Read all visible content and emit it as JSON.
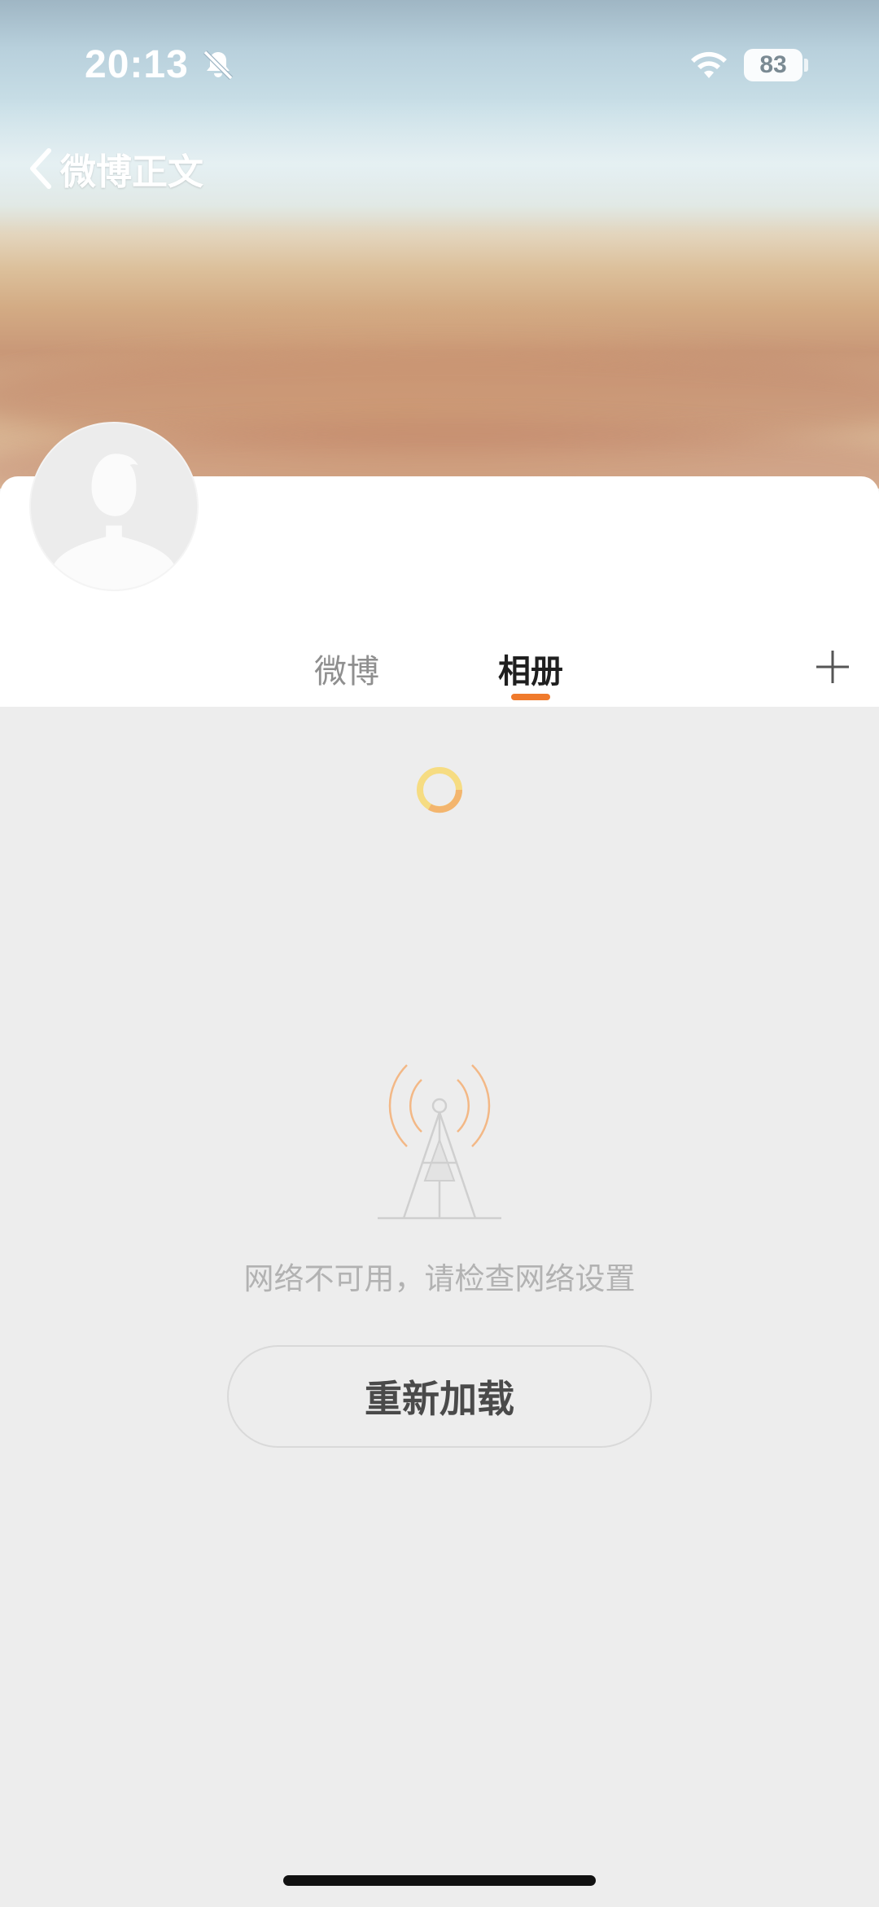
{
  "status_bar": {
    "time": "20:13",
    "battery_level": "83",
    "icons": [
      "bell-muted-icon",
      "wifi-icon",
      "battery-icon"
    ]
  },
  "nav": {
    "back_label": "微博正文",
    "back_icon": "chevron-left-icon"
  },
  "profile": {
    "avatar_icon": "default-avatar-icon"
  },
  "tabs": [
    {
      "label": "微博",
      "active": false
    },
    {
      "label": "相册",
      "active": true
    }
  ],
  "tab_add_icon": "plus-icon",
  "content": {
    "loading_icon": "loading-spinner-icon",
    "error_icon": "signal-tower-icon",
    "error_message": "网络不可用，请检查网络设置",
    "reload_label": "重新加载"
  },
  "colors": {
    "accent": "#f07a2c",
    "page_background": "#ededed",
    "active_tab_text": "#1f1f1f",
    "inactive_tab_text": "#8f8f8f",
    "error_text": "#b2b2b2"
  }
}
